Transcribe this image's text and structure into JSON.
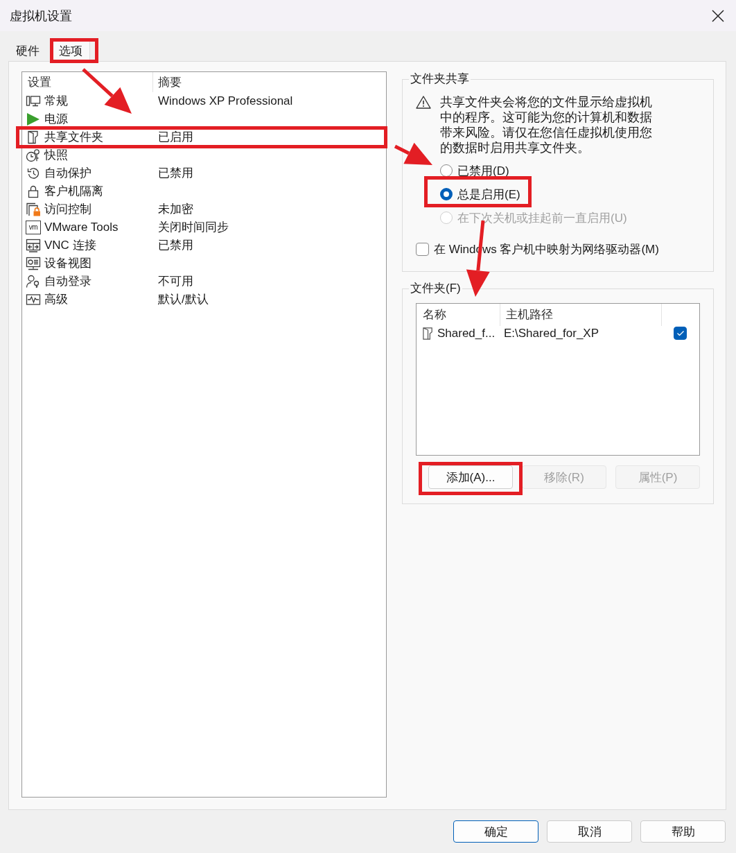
{
  "window": {
    "title": "虚拟机设置"
  },
  "tabs": [
    {
      "label": "硬件",
      "selected": false,
      "highlighted": false
    },
    {
      "label": "选项",
      "selected": true,
      "highlighted": true
    }
  ],
  "settings": {
    "columns": [
      "设置",
      "摘要"
    ],
    "rows": [
      {
        "kind": "general",
        "name": "常规",
        "summary": "Windows XP Professional",
        "highlighted": false
      },
      {
        "kind": "power",
        "name": "电源",
        "highlighted": false
      },
      {
        "kind": "shared_folders",
        "name": "共享文件夹",
        "summary": "已启用",
        "highlighted": true
      },
      {
        "kind": "snapshots",
        "name": "快照",
        "highlighted": false
      },
      {
        "kind": "autoprotect",
        "name": "自动保护",
        "summary": "已禁用",
        "highlighted": false
      },
      {
        "kind": "isolation",
        "name": "客户机隔离",
        "highlighted": false
      },
      {
        "kind": "access_control",
        "name": "访问控制",
        "summary": "未加密",
        "highlighted": false
      },
      {
        "kind": "vmware_tools",
        "icon_text": "vm",
        "name": "VMware Tools",
        "summary": "关闭时间同步",
        "highlighted": false
      },
      {
        "kind": "vnc",
        "name": "VNC 连接",
        "summary": "已禁用",
        "highlighted": false
      },
      {
        "kind": "appliance_view",
        "name": "设备视图",
        "highlighted": false
      },
      {
        "kind": "autologin",
        "name": "自动登录",
        "summary": "不可用",
        "highlighted": false
      },
      {
        "kind": "advanced",
        "name": "高级",
        "summary": "默认/默认",
        "highlighted": false
      }
    ]
  },
  "folder_sharing": {
    "title": "文件夹共享",
    "warning": "共享文件夹会将您的文件显示给虚拟机中的程序。这可能为您的计算机和数据带来风险。请仅在您信任虚拟机使用您的数据时启用共享文件夹。",
    "options": [
      {
        "label": "已禁用(D)",
        "selected": false,
        "disabled": false,
        "highlighted": false
      },
      {
        "label": "总是启用(E)",
        "selected": true,
        "disabled": false,
        "highlighted": true
      },
      {
        "label": "在下次关机或挂起前一直启用(U)",
        "selected": false,
        "disabled": true,
        "highlighted": false
      }
    ],
    "map_drive": {
      "label": "在 Windows 客户机中映射为网络驱动器(M)",
      "checked": false
    }
  },
  "folders": {
    "title": "文件夹(F)",
    "columns": [
      "名称",
      "主机路径"
    ],
    "rows": [
      {
        "name": "Shared_f...",
        "path": "E:\\Shared_for_XP",
        "enabled": true
      }
    ],
    "buttons": [
      {
        "label": "添加(A)...",
        "disabled": false,
        "highlighted": true
      },
      {
        "label": "移除(R)",
        "disabled": true,
        "highlighted": false
      },
      {
        "label": "属性(P)",
        "disabled": true,
        "highlighted": false
      }
    ]
  },
  "footer_buttons": [
    {
      "label": "确定",
      "default": true
    },
    {
      "label": "取消",
      "default": false
    },
    {
      "label": "帮助",
      "default": false
    }
  ]
}
